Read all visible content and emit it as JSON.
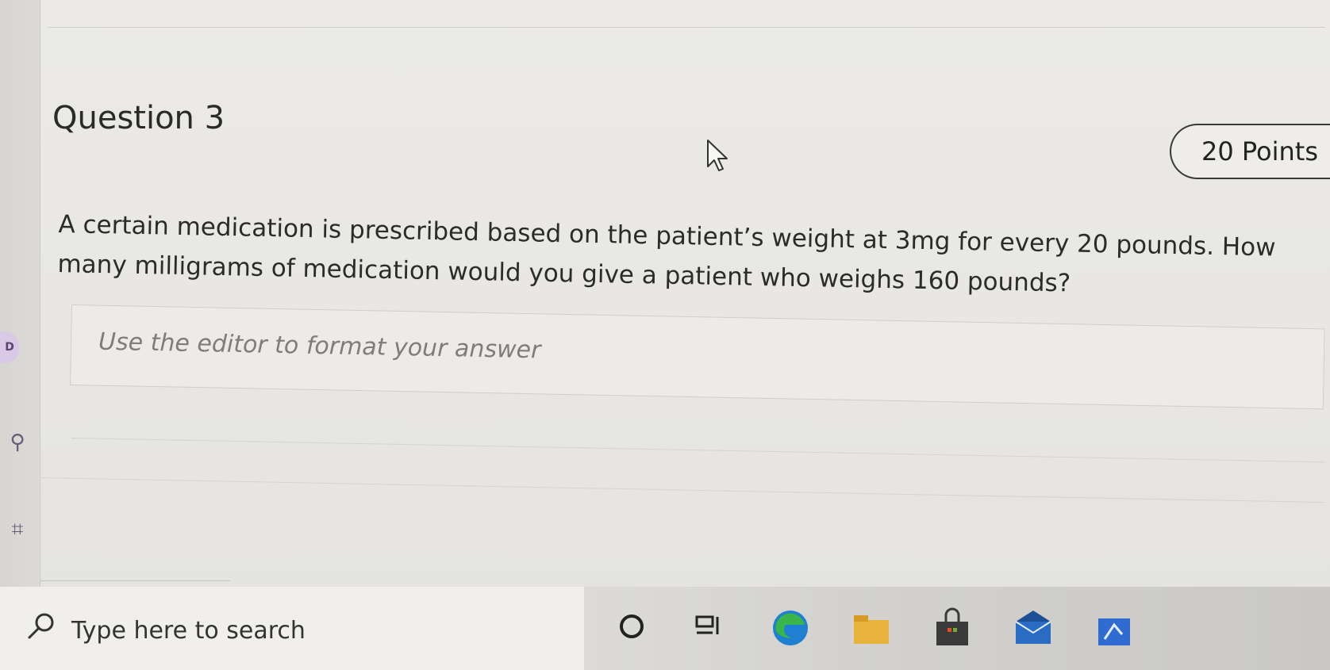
{
  "question": {
    "title": "Question 3",
    "points": "20 Points",
    "text": "A certain medication is prescribed based on the patient’s weight at 3mg for every 20 pounds. How many milligrams of medication would you give a patient who weighs 160 pounds?"
  },
  "answer_editor": {
    "placeholder": "Use the editor to format your answer"
  },
  "taskbar": {
    "search_placeholder": "Type here to search",
    "items": [
      "cortana-icon",
      "task-view-icon",
      "edge-icon",
      "file-explorer-icon",
      "store-icon",
      "mail-icon",
      "app-icon"
    ]
  },
  "colors": {
    "page_bg": "#e9e8e4",
    "text": "#2b2b2b",
    "placeholder": "#7e7d7a",
    "edge_blue": "#1f7fd0",
    "edge_green": "#3ab54a",
    "folder_yellow": "#e8b33a",
    "mail_blue": "#2a6cc4"
  }
}
